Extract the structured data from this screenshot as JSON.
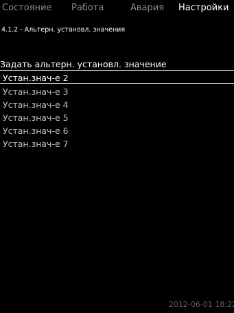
{
  "tabs": [
    {
      "label": "Состояние",
      "active": false
    },
    {
      "label": "Работа",
      "active": false
    },
    {
      "label": "Авария",
      "active": false
    },
    {
      "label": "Настройки",
      "active": true
    }
  ],
  "breadcrumb": "4.1.2 - Альтерн. установл. значения",
  "section_title": "Задать альтерн. установл. значение",
  "items": [
    {
      "label": "Устан.знач-е 2",
      "selected": true
    },
    {
      "label": "Устан.знач-е 3",
      "selected": false
    },
    {
      "label": "Устан.знач-е 4",
      "selected": false
    },
    {
      "label": "Устан.знач-е 5",
      "selected": false
    },
    {
      "label": "Устан.знач-е 6",
      "selected": false
    },
    {
      "label": "Устан.знач-е 7",
      "selected": false
    }
  ],
  "timestamp": "2012-06-01 18:22",
  "colors": {
    "background": "#000000",
    "text": "#ffffff",
    "inactive_tab": "#8a8a8a",
    "list_item": "#bdbdbd",
    "timestamp": "#5e5e5e"
  }
}
